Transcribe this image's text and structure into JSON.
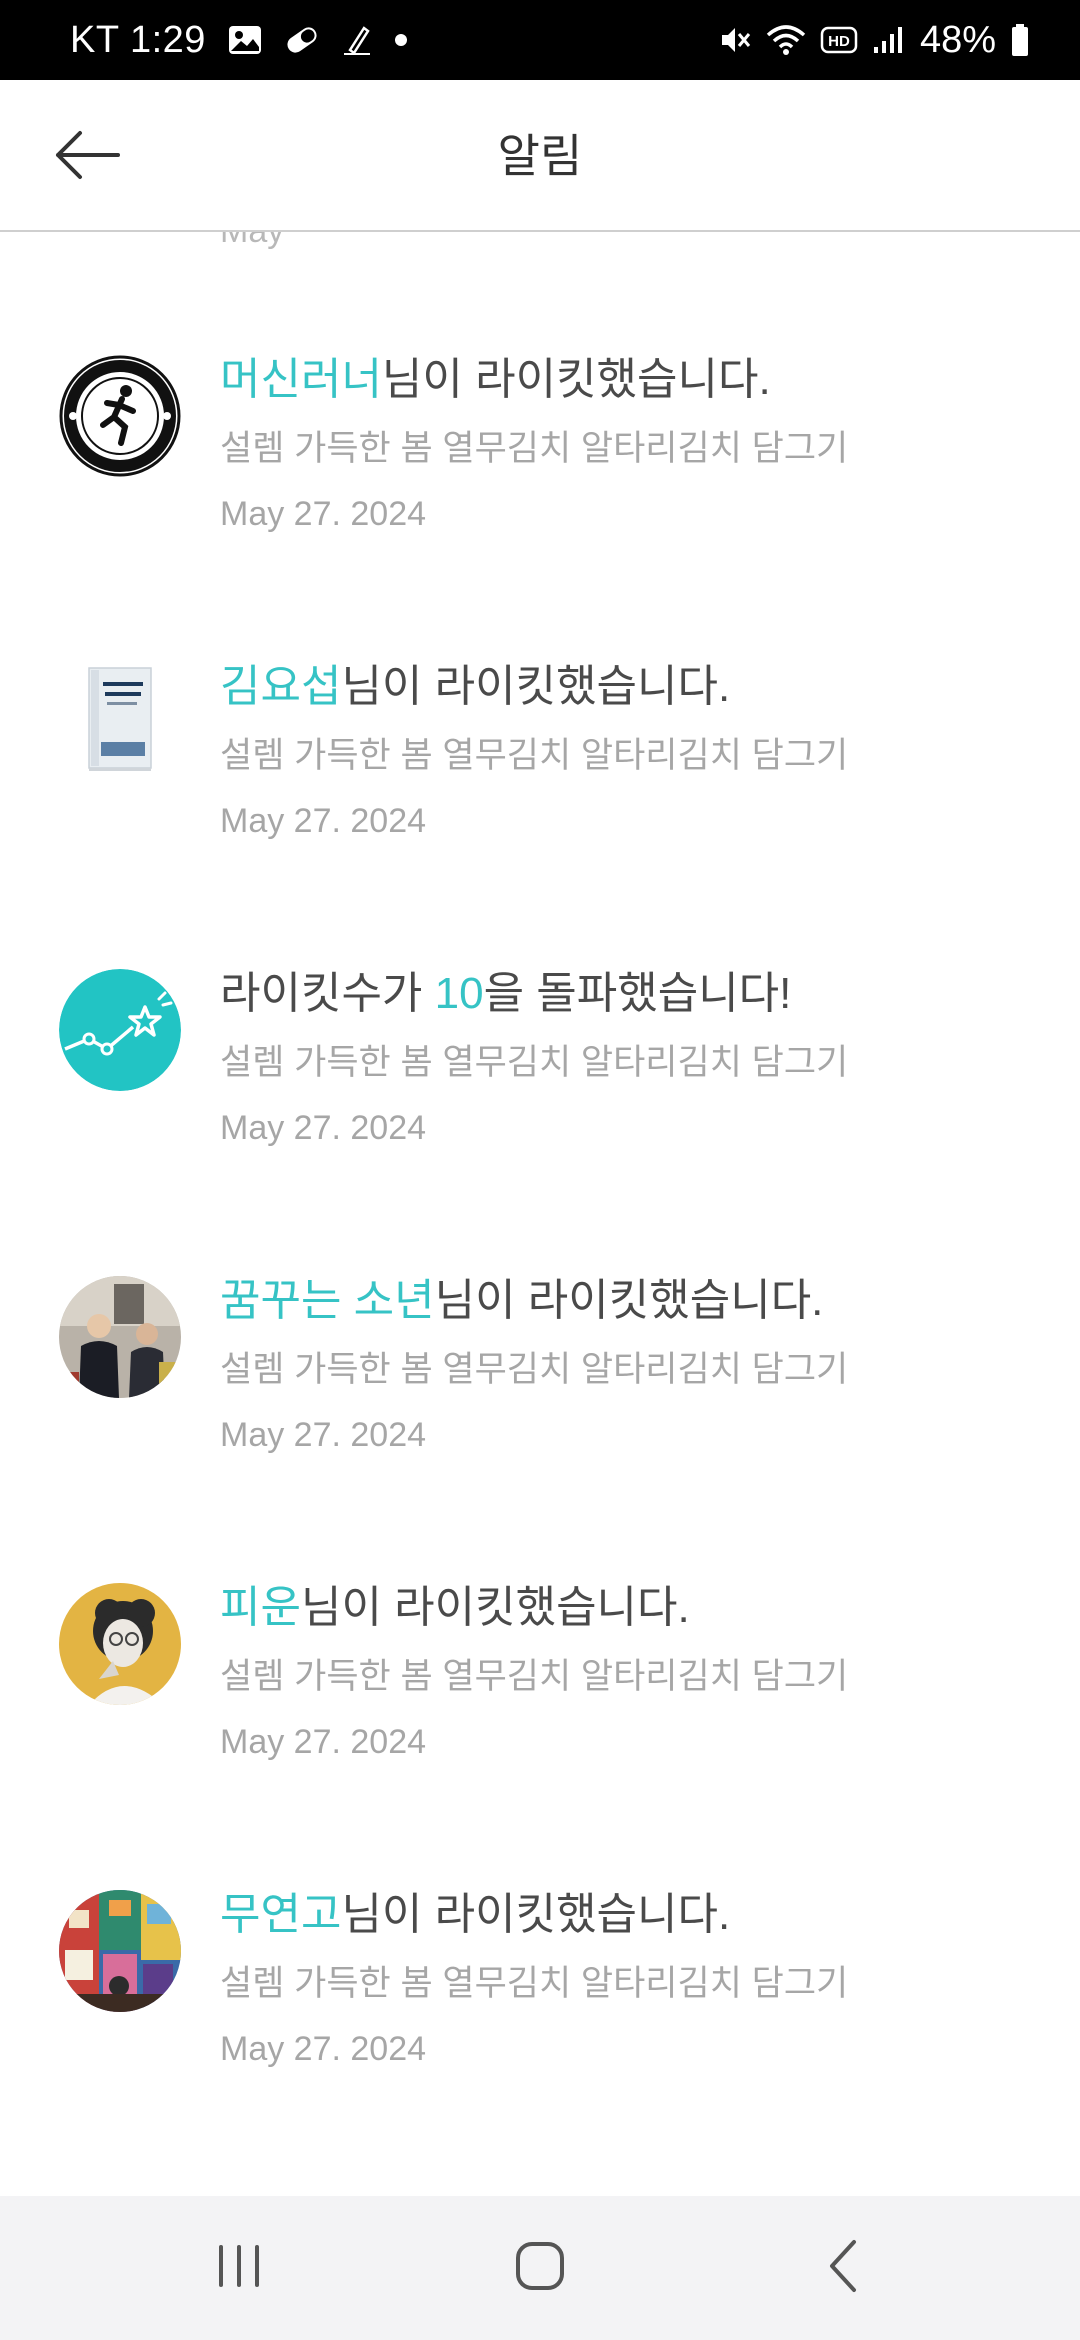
{
  "status_bar": {
    "carrier": "KT",
    "time": "1:29",
    "battery_percent": "48%",
    "icons_left": [
      "image-icon",
      "pill-icon",
      "pen-icon",
      "dot-icon"
    ],
    "icons_right": [
      "mute-icon",
      "wifi-icon",
      "hd-icon",
      "signal-icon",
      "battery-icon"
    ]
  },
  "header": {
    "title": "알림",
    "back_icon": "arrow-left-icon"
  },
  "peek_text": "May",
  "notifications": [
    {
      "highlight": "머신러너",
      "message": "님이 라이킷했습니다.",
      "subtitle": "설렘 가득한 봄 열무김치 알타리김치 담그기",
      "date": "May 27. 2024",
      "avatar": "machine-runner-logo"
    },
    {
      "highlight": "김요섭",
      "message": "님이 라이킷했습니다.",
      "subtitle": "설렘 가득한 봄 열무김치 알타리김치 담그기",
      "date": "May 27. 2024",
      "avatar": "book-cover"
    },
    {
      "prefix": "라이킷수가 ",
      "highlight": "10",
      "message": "을 돌파했습니다!",
      "subtitle": "설렘 가득한 봄 열무김치 알타리김치 담그기",
      "date": "May 27. 2024",
      "avatar": "milestone-star-icon"
    },
    {
      "highlight": "꿈꾸는 소년",
      "message": "님이 라이킷했습니다.",
      "subtitle": "설렘 가득한 봄 열무김치 알타리김치 담그기",
      "date": "May 27. 2024",
      "avatar": "photo-people"
    },
    {
      "highlight": "피운",
      "message": "님이 라이킷했습니다.",
      "subtitle": "설렘 가득한 봄 열무김치 알타리김치 담그기",
      "date": "May 27. 2024",
      "avatar": "portrait-yellow"
    },
    {
      "highlight": "무연고",
      "message": "님이 라이킷했습니다.",
      "subtitle": "설렘 가득한 봄 열무김치 알타리김치 담그기",
      "date": "May 27. 2024",
      "avatar": "colorful-illustration"
    }
  ],
  "nav": {
    "recents_icon": "recents-icon",
    "home_icon": "home-icon",
    "back_icon": "back-icon"
  },
  "colors": {
    "accent": "#36c3c5",
    "text": "#4a4a4a",
    "muted": "#a6a6a6"
  }
}
